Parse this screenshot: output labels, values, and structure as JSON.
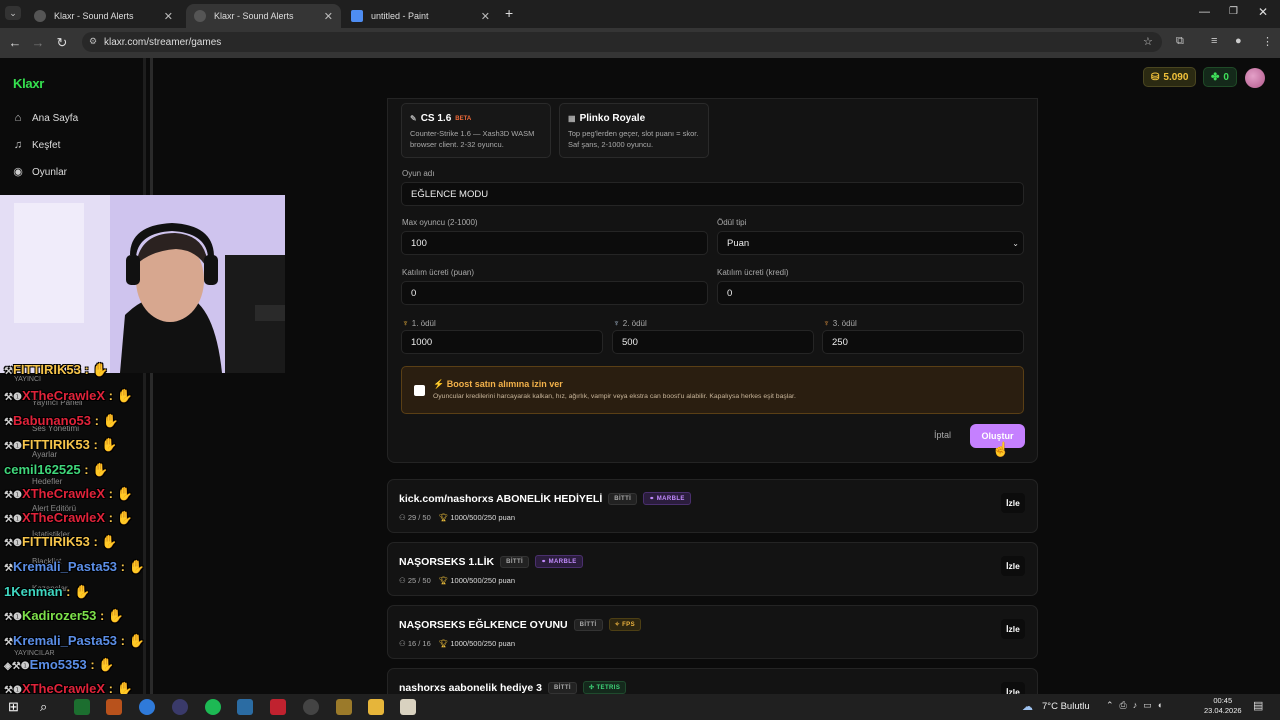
{
  "browser": {
    "tabs": [
      {
        "label": "Klaxr - Sound Alerts",
        "active": false
      },
      {
        "label": "Klaxr - Sound Alerts",
        "active": true
      },
      {
        "label": "untitled - Paint",
        "active": false
      }
    ],
    "url": "klaxr.com/streamer/games"
  },
  "sidebar": {
    "logo": "Klaxr",
    "items": [
      {
        "label": "Ana Sayfa",
        "icon": "home-icon"
      },
      {
        "label": "Keşfet",
        "icon": "music-icon"
      },
      {
        "label": "Oyunlar",
        "icon": "gamepad-icon"
      }
    ],
    "obscured_items": [
      "YAYINCI",
      "Yayıncı Paneli",
      "Ses Yönetimi",
      "Ayarlar",
      "Hedefler",
      "Alert Editörü",
      "İstatistikler",
      "Blacklist",
      "Kazançlar",
      "YAYINCILAR"
    ]
  },
  "header": {
    "coins": "5.090",
    "credits": "0"
  },
  "create": {
    "games": [
      {
        "title": "CS 1.6",
        "badge": "BETA",
        "desc": "Counter-Strike 1.6 — Xash3D WASM browser client. 2-32 oyuncu."
      },
      {
        "title": "Plinko Royale",
        "badge": "",
        "desc": "Top peg'lerden geçer, slot puanı = skor. Saf şans, 2-1000 oyuncu."
      }
    ],
    "name_label": "Oyun adı",
    "name_value": "EĞLENCE MODU",
    "max_label": "Max oyuncu (2-1000)",
    "max_value": "100",
    "reward_type_label": "Ödül tipi",
    "reward_type_value": "Puan",
    "fee_points_label": "Katılım ücreti (puan)",
    "fee_points_value": "0",
    "fee_credit_label": "Katılım ücreti (kredi)",
    "fee_credit_value": "0",
    "prize1_label": "1. ödül",
    "prize1_value": "1000",
    "prize2_label": "2. ödül",
    "prize2_value": "500",
    "prize3_label": "3. ödül",
    "prize3_value": "250",
    "boost_title": "Boost satın alımına izin ver",
    "boost_desc": "Oyuncular kredilerini harcayarak kalkan, hız, ağırlık, vampir veya ekstra can boost'u alabilir. Kapalıysa herkes eşit başlar.",
    "cancel": "İptal",
    "submit": "Oluştur"
  },
  "games_list": [
    {
      "name": "kick.com/nashorxs ABONELİK HEDİYELİ",
      "status": "BİTTİ",
      "type": "MARBLE",
      "type_class": "marble",
      "players": "29 / 50",
      "prize": "1000/500/250 puan",
      "action": "İzle"
    },
    {
      "name": "NAŞORSEKS 1.LİK",
      "status": "BİTTİ",
      "type": "MARBLE",
      "type_class": "marble",
      "players": "25 / 50",
      "prize": "1000/500/250 puan",
      "action": "İzle"
    },
    {
      "name": "NAŞORSEKS EĞLKENCE OYUNU",
      "status": "BİTTİ",
      "type": "FPS",
      "type_class": "fps",
      "players": "16 / 16",
      "prize": "1000/500/250 puan",
      "action": "İzle"
    },
    {
      "name": "nashorxs aabonelik hediye 3",
      "status": "BİTTİ",
      "type": "TETRIS",
      "type_class": "tetris",
      "players": "",
      "prize": "",
      "action": "İzle"
    }
  ],
  "chat": [
    {
      "user": "FITTIRIK53",
      "color": "#f6c54b"
    },
    {
      "user": "XTheCrawleX",
      "color": "#e0233a"
    },
    {
      "user": "Babunano53",
      "color": "#e0233a"
    },
    {
      "user": "FITTIRIK53",
      "color": "#f6c54b"
    },
    {
      "user": "cemil162525",
      "color": "#3fd67a"
    },
    {
      "user": "XTheCrawleX",
      "color": "#e0233a"
    },
    {
      "user": "XTheCrawleX",
      "color": "#e0233a"
    },
    {
      "user": "FITTIRIK53",
      "color": "#f6c54b"
    },
    {
      "user": "Kremali_Pasta53",
      "color": "#5b8ee6"
    },
    {
      "user": "1Kenman",
      "color": "#3fd6c0"
    },
    {
      "user": "Kadirozer53",
      "color": "#7de04a"
    },
    {
      "user": "Kremali_Pasta53",
      "color": "#5b8ee6"
    },
    {
      "user": "Emo5353",
      "color": "#5b8ee6"
    },
    {
      "user": "XTheCrawleX",
      "color": "#e0233a"
    }
  ],
  "taskbar": {
    "weather": "7°C Bulutlu",
    "time": "00:45",
    "date": "23.04.2026"
  },
  "colors": {
    "accent": "#c580ff",
    "coin": "#f2c23b",
    "credit": "#3fe05a",
    "boost_bg": "#2a1e10"
  }
}
